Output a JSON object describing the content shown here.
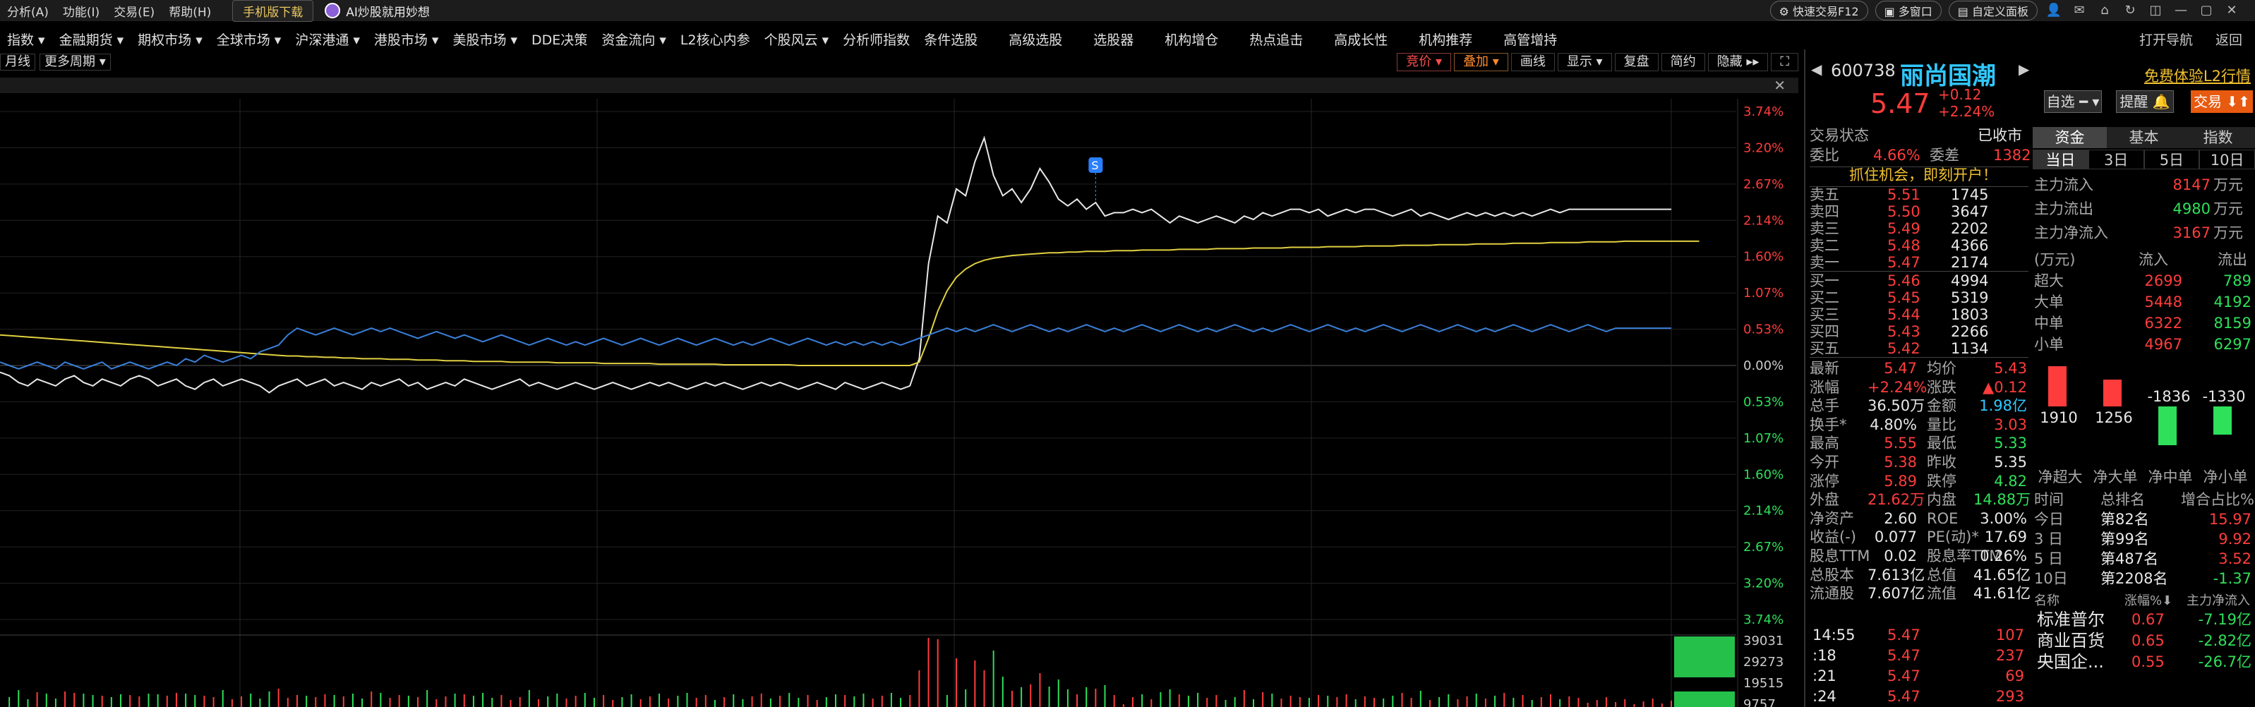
{
  "menu": {
    "items": [
      "分析(A)",
      "功能(I)",
      "交易(E)",
      "帮助(H)"
    ],
    "mobile_download": "手机版下载",
    "ai": "AI炒股就用妙想",
    "quick_trade": "快速交易F12",
    "multi_window": "多窗口",
    "custom_panel": "自定义面板"
  },
  "nav": {
    "items": [
      "指数 ▾",
      "金融期货 ▾",
      "期权市场 ▾",
      "全球市场 ▾",
      "沪深港通 ▾",
      "港股市场 ▾",
      "美股市场 ▾",
      "DDE决策",
      "资金流向 ▾",
      "L2核心内参",
      "个股风云 ▾",
      "分析师指数",
      "条件选股"
    ],
    "wide_items": [
      "高级选股",
      "选股器",
      "机构增仓",
      "热点追击",
      "高成长性",
      "机构推荐",
      "高管增持"
    ],
    "right": [
      "打开导航",
      "返回"
    ]
  },
  "chart_toolbar": {
    "left": [
      "月线",
      "更多周期 ▾"
    ],
    "right_red": "竞价 ▾",
    "right_org": "叠加 ▾",
    "right": [
      "画线",
      "显示 ▾",
      "复盘",
      "简约",
      "隐藏 ▸▸"
    ]
  },
  "colors": {
    "up": "#ff3c3c",
    "down": "#2ee05a",
    "price_line": "#e8e8e8",
    "avg_line": "#e0d040",
    "index_line": "#3a7fd8",
    "axis_up": "#ff3c3c",
    "axis_down": "#2ee05a",
    "accent": "#30c8ff"
  },
  "chart_data": {
    "type": "line",
    "yaxis_up": [
      "3.74%",
      "3.20%",
      "2.67%",
      "2.14%",
      "1.60%",
      "1.07%",
      "0.53%"
    ],
    "yaxis_zero": "0.00%",
    "yaxis_down": [
      "0.53%",
      "1.07%",
      "1.60%",
      "2.14%",
      "2.67%",
      "3.20%",
      "3.74%"
    ],
    "ylim_pct": [
      -3.74,
      3.74
    ],
    "volume_axis": [
      "39031",
      "29273",
      "19515",
      "9757"
    ],
    "signal_marker": "S",
    "series": [
      {
        "role": "price",
        "color": "#e8e8e8",
        "values": [
          -0.1,
          -0.15,
          -0.25,
          -0.3,
          -0.2,
          -0.25,
          -0.3,
          -0.2,
          -0.15,
          -0.25,
          -0.3,
          -0.2,
          -0.25,
          -0.3,
          -0.2,
          -0.15,
          -0.2,
          -0.3,
          -0.25,
          -0.2,
          -0.3,
          -0.35,
          -0.25,
          -0.2,
          -0.3,
          -0.25,
          -0.2,
          -0.25,
          -0.3,
          -0.4,
          -0.3,
          -0.25,
          -0.2,
          -0.3,
          -0.25,
          -0.2,
          -0.3,
          -0.25,
          -0.3,
          -0.35,
          -0.25,
          -0.3,
          -0.25,
          -0.2,
          -0.3,
          -0.25,
          -0.35,
          -0.3,
          -0.25,
          -0.3,
          -0.2,
          -0.25,
          -0.3,
          -0.35,
          -0.3,
          -0.25,
          -0.2,
          -0.3,
          -0.25,
          -0.3,
          -0.35,
          -0.3,
          -0.25,
          -0.3,
          -0.35,
          -0.3,
          -0.25,
          -0.3,
          -0.35,
          -0.3,
          -0.25,
          -0.3,
          -0.25,
          -0.3,
          -0.35,
          -0.3,
          -0.25,
          -0.3,
          -0.25,
          -0.3,
          -0.35,
          -0.3,
          -0.25,
          -0.3,
          -0.25,
          -0.3,
          -0.35,
          -0.3,
          -0.25,
          -0.3,
          -0.35,
          -0.25,
          -0.3,
          -0.35,
          -0.3,
          -0.25,
          -0.3,
          -0.35,
          -0.3,
          0.1,
          1.5,
          2.2,
          2.1,
          2.6,
          2.5,
          3.0,
          3.35,
          2.8,
          2.5,
          2.6,
          2.4,
          2.6,
          2.9,
          2.7,
          2.45,
          2.35,
          2.45,
          2.3,
          2.4,
          2.2,
          2.25,
          2.25,
          2.3,
          2.25,
          2.3,
          2.2,
          2.1,
          2.2,
          2.15,
          2.1,
          2.15,
          2.2,
          2.15,
          2.1,
          2.2,
          2.15,
          2.25,
          2.2,
          2.25,
          2.3,
          2.3,
          2.25,
          2.3,
          2.2,
          2.25,
          2.3,
          2.25,
          2.3,
          2.3,
          2.25,
          2.2,
          2.25,
          2.3,
          2.2,
          2.25,
          2.2,
          2.15,
          2.2,
          2.25,
          2.2,
          2.25,
          2.2,
          2.25,
          2.2,
          2.25,
          2.2,
          2.25,
          2.3,
          2.25,
          2.3,
          2.3,
          2.3,
          2.3,
          2.3,
          2.3,
          2.3,
          2.3,
          2.3,
          2.3,
          2.3,
          2.3
        ]
      },
      {
        "role": "average",
        "color": "#e0d040",
        "values": [
          0.45,
          0.44,
          0.43,
          0.42,
          0.41,
          0.4,
          0.39,
          0.38,
          0.37,
          0.36,
          0.35,
          0.34,
          0.33,
          0.32,
          0.31,
          0.3,
          0.29,
          0.28,
          0.27,
          0.26,
          0.25,
          0.24,
          0.23,
          0.22,
          0.21,
          0.2,
          0.19,
          0.18,
          0.17,
          0.16,
          0.15,
          0.14,
          0.14,
          0.13,
          0.13,
          0.12,
          0.12,
          0.11,
          0.11,
          0.1,
          0.1,
          0.1,
          0.09,
          0.09,
          0.09,
          0.08,
          0.08,
          0.08,
          0.07,
          0.07,
          0.07,
          0.06,
          0.06,
          0.06,
          0.06,
          0.05,
          0.05,
          0.05,
          0.05,
          0.05,
          0.04,
          0.04,
          0.04,
          0.04,
          0.04,
          0.03,
          0.03,
          0.03,
          0.03,
          0.03,
          0.03,
          0.02,
          0.02,
          0.02,
          0.02,
          0.02,
          0.02,
          0.02,
          0.01,
          0.01,
          0.01,
          0.01,
          0.01,
          0.01,
          0.01,
          0.01,
          0.0,
          0.0,
          0.0,
          0.0,
          0.0,
          0.0,
          0.0,
          0.0,
          0.0,
          0.0,
          0.0,
          0.0,
          0.0,
          0.05,
          0.4,
          0.8,
          1.1,
          1.3,
          1.42,
          1.5,
          1.55,
          1.58,
          1.6,
          1.62,
          1.63,
          1.64,
          1.65,
          1.66,
          1.66,
          1.67,
          1.67,
          1.68,
          1.68,
          1.68,
          1.69,
          1.69,
          1.69,
          1.7,
          1.7,
          1.7,
          1.7,
          1.71,
          1.71,
          1.71,
          1.71,
          1.72,
          1.72,
          1.72,
          1.72,
          1.73,
          1.73,
          1.73,
          1.73,
          1.74,
          1.74,
          1.74,
          1.74,
          1.75,
          1.75,
          1.75,
          1.75,
          1.76,
          1.76,
          1.76,
          1.76,
          1.77,
          1.77,
          1.77,
          1.77,
          1.78,
          1.78,
          1.78,
          1.78,
          1.79,
          1.79,
          1.79,
          1.79,
          1.8,
          1.8,
          1.8,
          1.8,
          1.81,
          1.81,
          1.81,
          1.81,
          1.82,
          1.82,
          1.82,
          1.82,
          1.83,
          1.83,
          1.83,
          1.83,
          1.83,
          1.83,
          1.83,
          1.83,
          1.83
        ]
      },
      {
        "role": "index",
        "color": "#3a7fd8",
        "values": [
          0.05,
          0.0,
          -0.05,
          0.0,
          0.05,
          0.0,
          -0.05,
          0.05,
          0.0,
          -0.05,
          0.0,
          0.05,
          -0.05,
          0.0,
          0.05,
          0.0,
          -0.05,
          0.0,
          0.05,
          0.0,
          0.1,
          0.05,
          0.15,
          0.1,
          0.05,
          0.1,
          0.15,
          0.1,
          0.2,
          0.25,
          0.3,
          0.45,
          0.55,
          0.5,
          0.45,
          0.5,
          0.55,
          0.5,
          0.45,
          0.5,
          0.55,
          0.5,
          0.55,
          0.5,
          0.45,
          0.4,
          0.45,
          0.5,
          0.45,
          0.4,
          0.45,
          0.4,
          0.35,
          0.4,
          0.45,
          0.4,
          0.35,
          0.3,
          0.35,
          0.4,
          0.35,
          0.3,
          0.35,
          0.3,
          0.35,
          0.4,
          0.35,
          0.3,
          0.35,
          0.4,
          0.35,
          0.3,
          0.35,
          0.4,
          0.35,
          0.3,
          0.35,
          0.4,
          0.35,
          0.3,
          0.35,
          0.3,
          0.35,
          0.4,
          0.35,
          0.3,
          0.35,
          0.4,
          0.35,
          0.3,
          0.35,
          0.3,
          0.35,
          0.3,
          0.35,
          0.3,
          0.35,
          0.3,
          0.35,
          0.4,
          0.45,
          0.5,
          0.55,
          0.5,
          0.55,
          0.5,
          0.55,
          0.6,
          0.55,
          0.5,
          0.55,
          0.6,
          0.55,
          0.5,
          0.55,
          0.5,
          0.55,
          0.6,
          0.55,
          0.5,
          0.55,
          0.5,
          0.55,
          0.6,
          0.55,
          0.5,
          0.55,
          0.6,
          0.55,
          0.5,
          0.55,
          0.5,
          0.55,
          0.6,
          0.55,
          0.5,
          0.55,
          0.5,
          0.55,
          0.6,
          0.55,
          0.5,
          0.55,
          0.6,
          0.55,
          0.5,
          0.55,
          0.5,
          0.55,
          0.6,
          0.55,
          0.5,
          0.55,
          0.6,
          0.55,
          0.5,
          0.55,
          0.6,
          0.55,
          0.5,
          0.55,
          0.5,
          0.55,
          0.6,
          0.55,
          0.5,
          0.55,
          0.6,
          0.55,
          0.5,
          0.55,
          0.6,
          0.55,
          0.5,
          0.55,
          0.55,
          0.55,
          0.55,
          0.55,
          0.55,
          0.55
        ]
      }
    ]
  },
  "quote": {
    "code": "600738",
    "name": "丽尚国潮",
    "l2": "免费体验L2行情",
    "price": "5.47",
    "change": "+0.12",
    "change_pct": "+2.24%",
    "select_btn": "自选 ━ ▾",
    "remind_btn": "提醒 🔔",
    "trade_btn": "交易 ⬇⬆",
    "status_label": "交易状态",
    "status": "已收市",
    "webi_label": "委比",
    "webi": "4.66%",
    "weicha_label": "委差",
    "weicha": "1382",
    "promo": "抓住机会，即刻开户！",
    "asks": [
      {
        "l": "卖五",
        "p": "5.51",
        "v": "1745"
      },
      {
        "l": "卖四",
        "p": "5.50",
        "v": "3647"
      },
      {
        "l": "卖三",
        "p": "5.49",
        "v": "2202"
      },
      {
        "l": "卖二",
        "p": "5.48",
        "v": "4366"
      },
      {
        "l": "卖一",
        "p": "5.47",
        "v": "2174"
      }
    ],
    "bids": [
      {
        "l": "买一",
        "p": "5.46",
        "v": "4994"
      },
      {
        "l": "买二",
        "p": "5.45",
        "v": "5319"
      },
      {
        "l": "买三",
        "p": "5.44",
        "v": "1803"
      },
      {
        "l": "买四",
        "p": "5.43",
        "v": "2266"
      },
      {
        "l": "买五",
        "p": "5.42",
        "v": "1134"
      }
    ],
    "stats": [
      [
        "最新",
        "5.47",
        "red",
        "均价",
        "5.43",
        "red"
      ],
      [
        "涨幅",
        "+2.24%",
        "red",
        "涨跌",
        "▲0.12",
        "red"
      ],
      [
        "总手",
        "36.50万",
        "wht",
        "金额",
        "1.98亿",
        "cyn"
      ],
      [
        "换手*",
        "4.80%",
        "wht",
        "量比",
        "3.03",
        "red"
      ],
      [
        "最高",
        "5.55",
        "red",
        "最低",
        "5.33",
        "grn"
      ],
      [
        "今开",
        "5.38",
        "red",
        "昨收",
        "5.35",
        "wht"
      ],
      [
        "涨停",
        "5.89",
        "red",
        "跌停",
        "4.82",
        "grn"
      ],
      [
        "外盘",
        "21.62万",
        "red",
        "内盘",
        "14.88万",
        "grn"
      ],
      [
        "净资产",
        "2.60",
        "wht",
        "ROE",
        "3.00%",
        "wht"
      ],
      [
        "收益(-)",
        "0.077",
        "wht",
        "PE(动)*",
        "17.69",
        "wht"
      ],
      [
        "股息TTM",
        "0.02",
        "wht",
        "股息率TTM",
        "0.26%",
        "wht"
      ],
      [
        "总股本",
        "7.613亿",
        "wht",
        "总值",
        "41.65亿",
        "wht"
      ],
      [
        "流通股",
        "7.607亿",
        "wht",
        "流值",
        "41.61亿",
        "wht"
      ]
    ],
    "ticks": [
      [
        "14:55",
        "5.47",
        "107"
      ],
      [
        ":18",
        "5.47",
        "237"
      ],
      [
        ":21",
        "5.47",
        "69"
      ],
      [
        ":24",
        "5.47",
        "293"
      ]
    ]
  },
  "capital": {
    "tabs": [
      "资金",
      "基本",
      "指数"
    ],
    "sub": [
      "当日",
      "3日",
      "5日",
      "10日"
    ],
    "main_in_label": "主力流入",
    "main_in": "8147",
    "main_out_label": "主力流出",
    "main_out": "4980",
    "main_net_label": "主力净流入",
    "main_net": "3167",
    "unit": "万元",
    "grid_head": [
      "(万元)",
      "流入",
      "流出"
    ],
    "grid": [
      [
        "超大",
        "2699",
        "789"
      ],
      [
        "大单",
        "5448",
        "4192"
      ],
      [
        "中单",
        "6322",
        "8159"
      ],
      [
        "小单",
        "4967",
        "6297"
      ]
    ],
    "bars": [
      {
        "label": "净超大",
        "value": 1910
      },
      {
        "label": "净大单",
        "value": 1256
      },
      {
        "label": "净中单",
        "value": -1836
      },
      {
        "label": "净小单",
        "value": -1330
      }
    ],
    "rank_head": [
      "时间",
      "总排名",
      "增合占比%"
    ],
    "rank": [
      [
        "今日",
        "第82名",
        "15.97"
      ],
      [
        "3 日",
        "第99名",
        "9.92"
      ],
      [
        "5 日",
        "第487名",
        "3.52"
      ],
      [
        "10日",
        "第2208名",
        "-1.37"
      ]
    ],
    "sector_head": [
      "名称",
      "涨幅%⬇",
      "主力净流入"
    ],
    "sectors": [
      [
        "标准普尔",
        "0.67",
        "-7.19亿"
      ],
      [
        "商业百货",
        "0.65",
        "-2.82亿"
      ],
      [
        "央国企...",
        "0.55",
        "-26.7亿"
      ]
    ]
  }
}
